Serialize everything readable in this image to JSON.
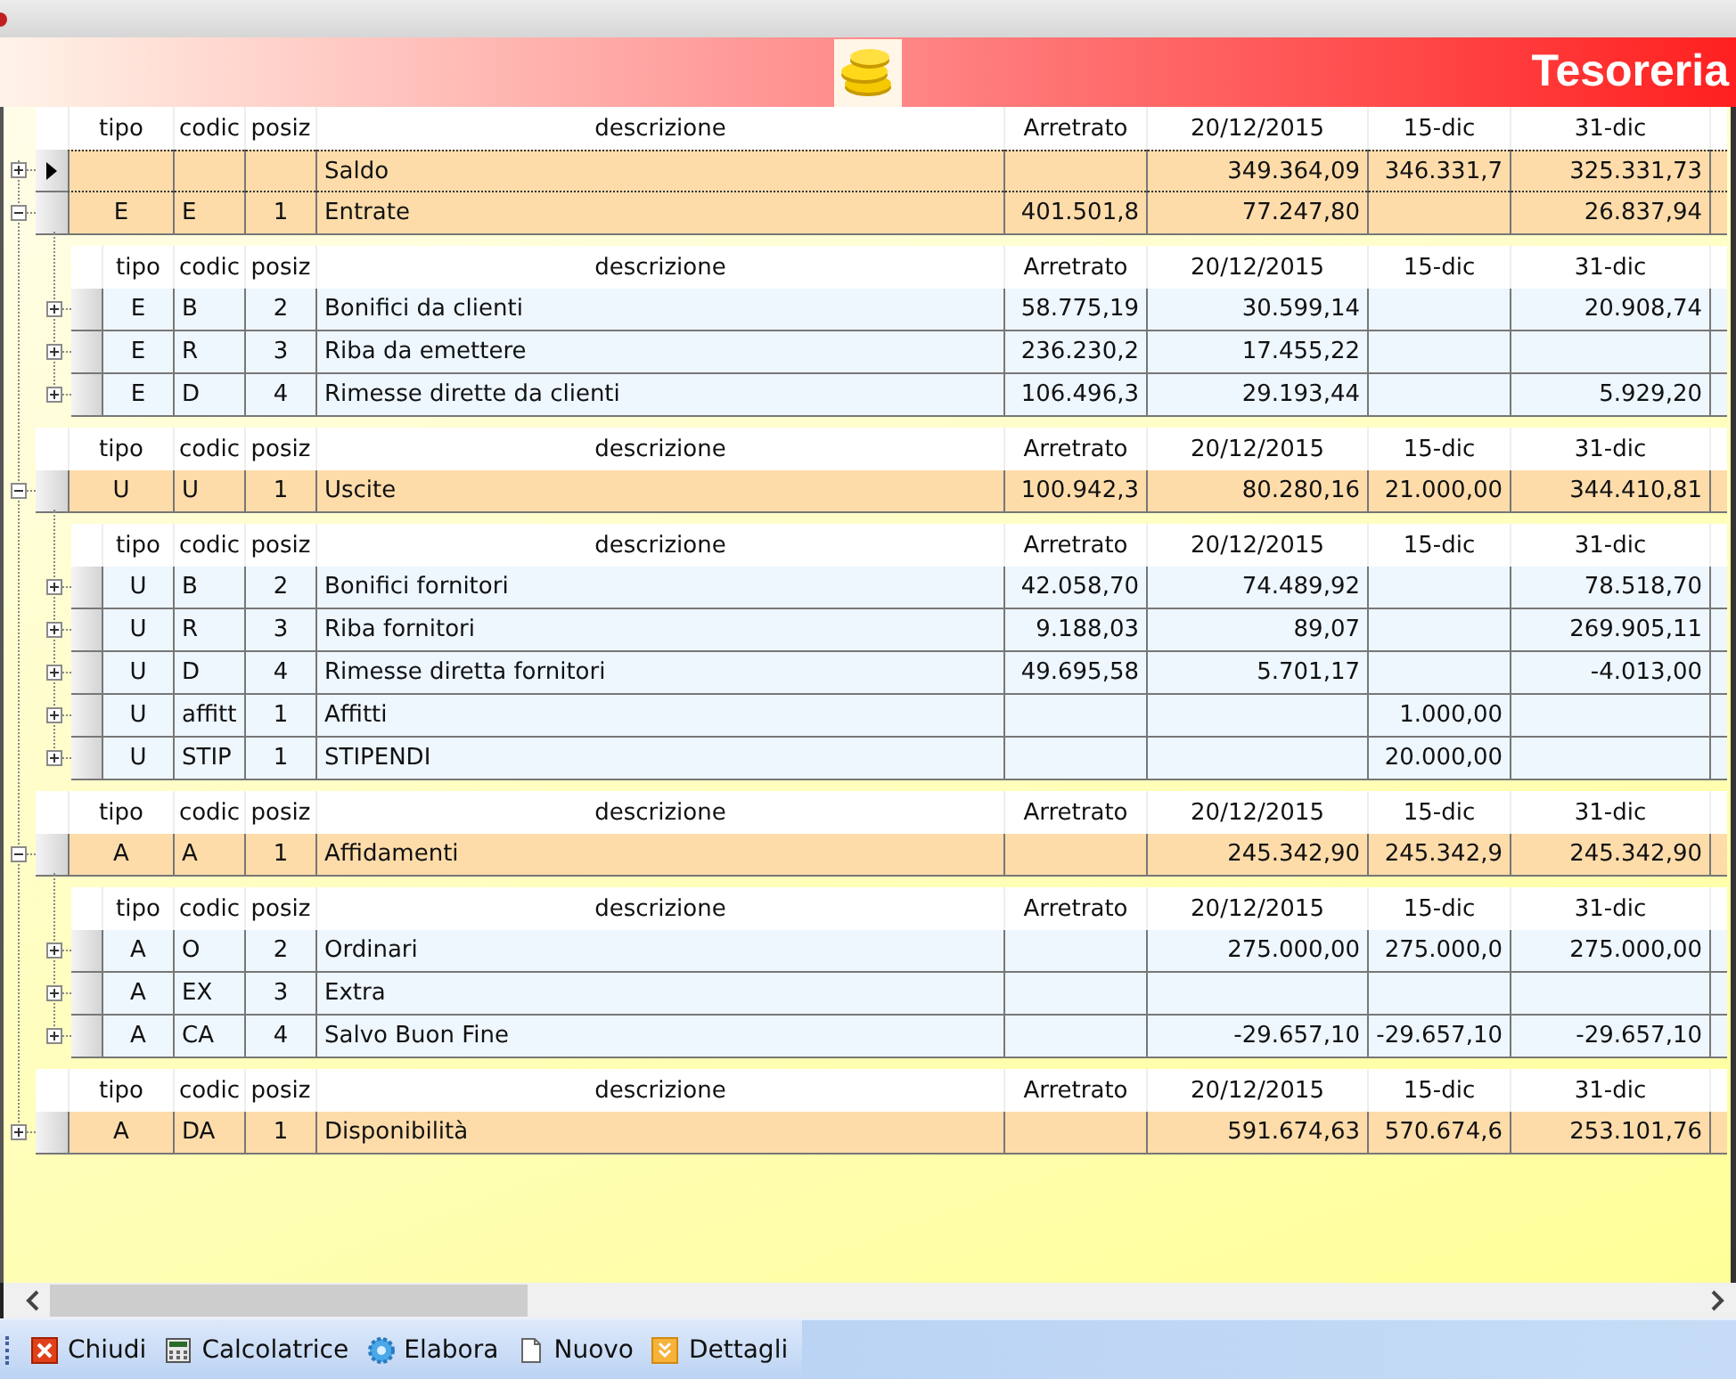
{
  "title": "Tesoreria",
  "bands": [
    {
      "columns": [
        "tipo",
        "codic",
        "posiz",
        "descrizione",
        "Arretrato",
        "20/12/2015",
        "15-dic",
        "31-dic"
      ],
      "rows": [
        {
          "current": true,
          "expanded": false,
          "cells": {
            "descrizione": "Saldo",
            "d1": "349.364,09",
            "d2": "346.331,7",
            "d3": "325.331,73"
          }
        },
        {
          "current": false,
          "expanded": true,
          "cells": {
            "tipo": "E",
            "codic": "E",
            "posiz": "1",
            "descrizione": "Entrate",
            "arretrato": "401.501,8",
            "d1": "77.247,80",
            "d3": "26.837,94"
          },
          "children": {
            "columns": [
              "tipo",
              "codic",
              "posiz",
              "descrizione",
              "Arretrato",
              "20/12/2015",
              "15-dic",
              "31-dic"
            ],
            "rows": [
              {
                "expanded": false,
                "cells": {
                  "tipo": "E",
                  "codic": "B",
                  "posiz": "2",
                  "descrizione": "Bonifici da clienti",
                  "arretrato": "58.775,19",
                  "d1": "30.599,14",
                  "d3": "20.908,74"
                }
              },
              {
                "expanded": false,
                "cells": {
                  "tipo": "E",
                  "codic": "R",
                  "posiz": "3",
                  "descrizione": "Riba da emettere",
                  "arretrato": "236.230,2",
                  "d1": "17.455,22"
                }
              },
              {
                "expanded": false,
                "cells": {
                  "tipo": "E",
                  "codic": "D",
                  "posiz": "4",
                  "descrizione": "Rimesse dirette da clienti",
                  "arretrato": "106.496,3",
                  "d1": "29.193,44",
                  "d3": "5.929,20"
                }
              }
            ]
          }
        }
      ]
    },
    {
      "columns": [
        "tipo",
        "codic",
        "posiz",
        "descrizione",
        "Arretrato",
        "20/12/2015",
        "15-dic",
        "31-dic"
      ],
      "rows": [
        {
          "current": false,
          "expanded": true,
          "cells": {
            "tipo": "U",
            "codic": "U",
            "posiz": "1",
            "descrizione": "Uscite",
            "arretrato": "100.942,3",
            "d1": "80.280,16",
            "d2": "21.000,00",
            "d3": "344.410,81"
          },
          "children": {
            "columns": [
              "tipo",
              "codic",
              "posiz",
              "descrizione",
              "Arretrato",
              "20/12/2015",
              "15-dic",
              "31-dic"
            ],
            "rows": [
              {
                "expanded": false,
                "cells": {
                  "tipo": "U",
                  "codic": "B",
                  "posiz": "2",
                  "descrizione": "Bonifici fornitori",
                  "arretrato": "42.058,70",
                  "d1": "74.489,92",
                  "d3": "78.518,70"
                }
              },
              {
                "expanded": false,
                "cells": {
                  "tipo": "U",
                  "codic": "R",
                  "posiz": "3",
                  "descrizione": "Riba fornitori",
                  "arretrato": "9.188,03",
                  "d1": "89,07",
                  "d3": "269.905,11"
                }
              },
              {
                "expanded": false,
                "cells": {
                  "tipo": "U",
                  "codic": "D",
                  "posiz": "4",
                  "descrizione": "Rimesse diretta fornitori",
                  "arretrato": "49.695,58",
                  "d1": "5.701,17",
                  "d3": "-4.013,00"
                }
              },
              {
                "expanded": false,
                "cells": {
                  "tipo": "U",
                  "codic": "affitt",
                  "posiz": "1",
                  "descrizione": "Affitti",
                  "d2": "1.000,00"
                }
              },
              {
                "expanded": false,
                "cells": {
                  "tipo": "U",
                  "codic": "STIP",
                  "posiz": "1",
                  "descrizione": "STIPENDI",
                  "d2": "20.000,00"
                }
              }
            ]
          }
        }
      ]
    },
    {
      "columns": [
        "tipo",
        "codic",
        "posiz",
        "descrizione",
        "Arretrato",
        "20/12/2015",
        "15-dic",
        "31-dic"
      ],
      "rows": [
        {
          "current": false,
          "expanded": true,
          "cells": {
            "tipo": "A",
            "codic": "A",
            "posiz": "1",
            "descrizione": "Affidamenti",
            "d1": "245.342,90",
            "d2": "245.342,9",
            "d3": "245.342,90"
          },
          "children": {
            "columns": [
              "tipo",
              "codic",
              "posiz",
              "descrizione",
              "Arretrato",
              "20/12/2015",
              "15-dic",
              "31-dic"
            ],
            "rows": [
              {
                "expanded": false,
                "cells": {
                  "tipo": "A",
                  "codic": "O",
                  "posiz": "2",
                  "descrizione": "Ordinari",
                  "d1": "275.000,00",
                  "d2": "275.000,0",
                  "d3": "275.000,00"
                }
              },
              {
                "expanded": false,
                "cells": {
                  "tipo": "A",
                  "codic": "EX",
                  "posiz": "3",
                  "descrizione": "Extra"
                }
              },
              {
                "expanded": false,
                "cells": {
                  "tipo": "A",
                  "codic": "CA",
                  "posiz": "4",
                  "descrizione": "Salvo Buon Fine",
                  "d1": "-29.657,10",
                  "d2": "-29.657,10",
                  "d3": "-29.657,10"
                }
              }
            ]
          }
        }
      ]
    },
    {
      "columns": [
        "tipo",
        "codic",
        "posiz",
        "descrizione",
        "Arretrato",
        "20/12/2015",
        "15-dic",
        "31-dic"
      ],
      "rows": [
        {
          "current": false,
          "expanded": false,
          "cells": {
            "tipo": "A",
            "codic": "DA",
            "posiz": "1",
            "descrizione": "Disponibilità",
            "d1": "591.674,63",
            "d2": "570.674,6",
            "d3": "253.101,76"
          }
        }
      ]
    }
  ],
  "toolbar": [
    {
      "kind": "close",
      "label": "Chiudi"
    },
    {
      "kind": "calculator",
      "label": "Calcolatrice"
    },
    {
      "kind": "gear",
      "label": "Elabora"
    },
    {
      "kind": "page",
      "label": "Nuovo"
    },
    {
      "kind": "details",
      "label": "Dettagli"
    }
  ]
}
